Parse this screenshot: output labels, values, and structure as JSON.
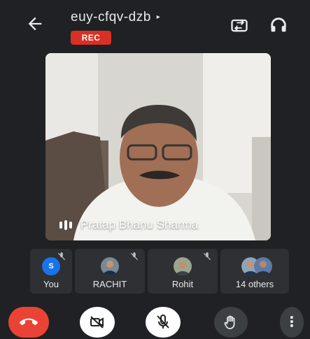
{
  "meeting": {
    "code": "euy-cfqv-dzb",
    "caret": "▸",
    "recording_badge": "REC"
  },
  "icons": {
    "back": "arrow-left-icon",
    "switch_camera": "camera-switch-icon",
    "audio": "headset-icon"
  },
  "main_video": {
    "speaker_name": "Pratap Bhanu Sharma",
    "audio_indicator": "audio-bars-icon"
  },
  "participants": [
    {
      "name": "You",
      "avatar_letter": "S",
      "muted": true
    },
    {
      "name": "RACHIT",
      "muted": true
    },
    {
      "name": "Rohit",
      "muted": true
    },
    {
      "name": "14 others"
    }
  ],
  "controls": {
    "end_call": "phone-hangup-icon",
    "camera": "camera-off-icon",
    "mic": "mic-off-icon",
    "raise_hand": "hand-icon",
    "more": "more-vert-icon",
    "more_glyph": "⋮"
  },
  "colors": {
    "background": "#1f2124",
    "tile": "#2e3033",
    "rec_badge": "#d93025",
    "end_call": "#ea4335",
    "avatar_you": "#1a73e8"
  }
}
